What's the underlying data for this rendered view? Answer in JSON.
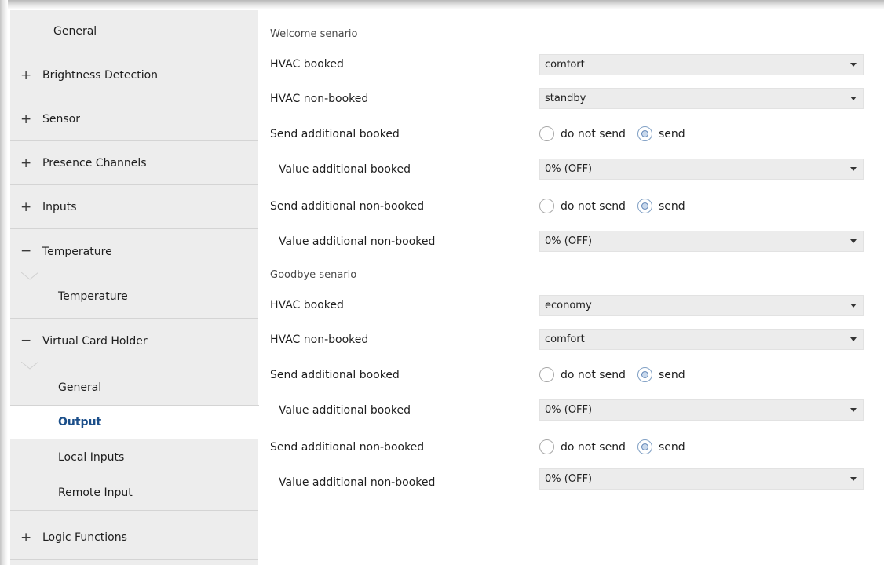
{
  "sidebar": {
    "items": [
      {
        "sign": "",
        "label": "General"
      },
      {
        "sign": "+",
        "label": "Brightness Detection"
      },
      {
        "sign": "+",
        "label": "Sensor"
      },
      {
        "sign": "+",
        "label": "Presence Channels"
      },
      {
        "sign": "+",
        "label": "Inputs"
      },
      {
        "sign": "−",
        "label": "Temperature"
      },
      {
        "sign": "",
        "label": "Temperature"
      },
      {
        "sign": "−",
        "label": "Virtual Card Holder"
      },
      {
        "sign": "",
        "label": "General"
      },
      {
        "sign": "",
        "label": "Output"
      },
      {
        "sign": "",
        "label": "Local Inputs"
      },
      {
        "sign": "",
        "label": "Remote Input"
      },
      {
        "sign": "+",
        "label": "Logic Functions"
      }
    ],
    "active_item": "Output"
  },
  "main": {
    "welcome": {
      "title": "Welcome senario",
      "hvac_booked": {
        "label": "HVAC booked",
        "value": "comfort"
      },
      "hvac_non_booked": {
        "label": "HVAC non-booked",
        "value": "standby"
      },
      "send_additional_booked": {
        "label": "Send additional booked",
        "option_a": "do not send",
        "option_b": "send",
        "selected": "send"
      },
      "value_additional_booked": {
        "label": "Value additional booked",
        "value": "0% (OFF)"
      },
      "send_additional_non_booked": {
        "label": "Send additional non-booked",
        "option_a": "do not send",
        "option_b": "send",
        "selected": "send"
      },
      "value_additional_non_booked": {
        "label": "Value additional non-booked",
        "value": "0% (OFF)"
      }
    },
    "goodbye": {
      "title": "Goodbye senario",
      "hvac_booked": {
        "label": "HVAC booked",
        "value": "economy"
      },
      "hvac_non_booked": {
        "label": "HVAC non-booked",
        "value": "comfort"
      },
      "send_additional_booked": {
        "label": "Send additional booked",
        "option_a": "do not send",
        "option_b": "send",
        "selected": "send"
      },
      "value_additional_booked": {
        "label": "Value additional booked",
        "value": "0% (OFF)"
      },
      "send_additional_non_booked": {
        "label": "Send additional non-booked",
        "option_a": "do not send",
        "option_b": "send",
        "selected": "send"
      },
      "value_additional_non_booked": {
        "label": "Value additional non-booked",
        "value": "0% (OFF)"
      }
    }
  },
  "colors": {
    "sidebar_bg": "#ededed",
    "active_text": "#1c4f8a",
    "dropdown_bg": "#ececec",
    "radio_checked": "#5f84b5"
  }
}
